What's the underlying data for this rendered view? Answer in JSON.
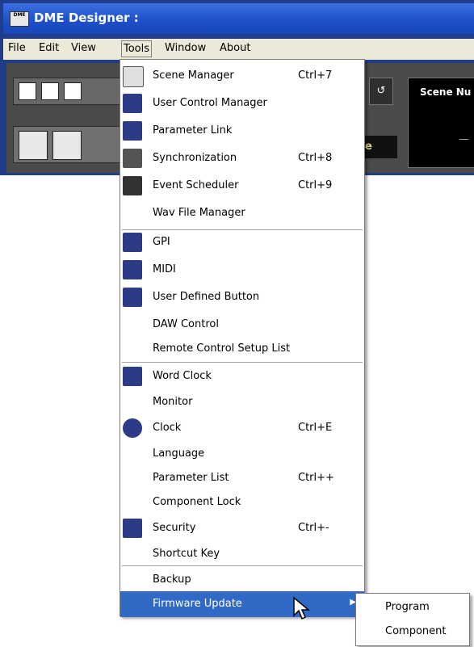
{
  "window": {
    "title": "DME Designer :",
    "app_icon_text": "DME"
  },
  "menubar": {
    "items": [
      "File",
      "Edit",
      "View",
      "Tools",
      "Window",
      "About"
    ]
  },
  "toolbar": {
    "scene_label": "Scene Nu",
    "scene_dash": "—",
    "partial_button": "e"
  },
  "tools_menu": {
    "items": [
      {
        "label": "Scene Manager",
        "shortcut": "Ctrl+7",
        "icon": "scene-manager-icon"
      },
      {
        "label": "User Control Manager",
        "shortcut": "",
        "icon": "user-control-icon"
      },
      {
        "label": "Parameter Link",
        "shortcut": "",
        "icon": "parameter-link-icon"
      },
      {
        "label": "Synchronization",
        "shortcut": "Ctrl+8",
        "icon": "synchronization-icon"
      },
      {
        "label": "Event Scheduler",
        "shortcut": "Ctrl+9",
        "icon": "event-scheduler-icon"
      },
      {
        "label": "Wav File Manager",
        "shortcut": "",
        "icon": ""
      },
      {
        "label": "GPI",
        "shortcut": "",
        "icon": "gpi-icon"
      },
      {
        "label": "MIDI",
        "shortcut": "",
        "icon": "midi-icon"
      },
      {
        "label": "User Defined Button",
        "shortcut": "",
        "icon": "user-defined-button-icon"
      },
      {
        "label": "DAW Control",
        "shortcut": "",
        "icon": ""
      },
      {
        "label": "Remote Control Setup List",
        "shortcut": "",
        "icon": ""
      },
      {
        "label": "Word Clock",
        "shortcut": "",
        "icon": "word-clock-icon"
      },
      {
        "label": "Monitor",
        "shortcut": "",
        "icon": ""
      },
      {
        "label": "Clock",
        "shortcut": "Ctrl+E",
        "icon": "clock-icon"
      },
      {
        "label": "Language",
        "shortcut": "",
        "icon": ""
      },
      {
        "label": "Parameter List",
        "shortcut": "Ctrl++",
        "icon": ""
      },
      {
        "label": "Component Lock",
        "shortcut": "",
        "icon": ""
      },
      {
        "label": "Security",
        "shortcut": "Ctrl+-",
        "icon": "security-icon"
      },
      {
        "label": "Shortcut Key",
        "shortcut": "",
        "icon": ""
      },
      {
        "label": "Backup",
        "shortcut": "",
        "icon": ""
      },
      {
        "label": "Firmware Update",
        "shortcut": "",
        "icon": ""
      }
    ],
    "submenu_arrow": "▶"
  },
  "firmware_submenu": {
    "items": [
      "Program",
      "Component"
    ]
  },
  "colors": {
    "highlight": "#3169c6",
    "titlebar": "#1d4fc9"
  }
}
